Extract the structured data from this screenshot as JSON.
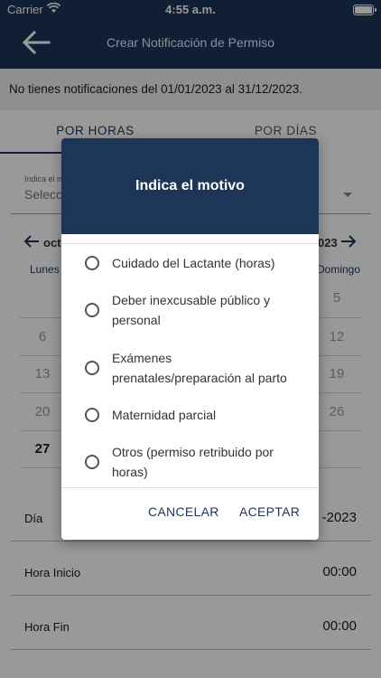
{
  "status_bar": {
    "carrier": "Carrier",
    "time": "4:55 a.m."
  },
  "header": {
    "title": "Crear Notificación de Permiso"
  },
  "banner": {
    "text": "No tienes notificaciones del 01/01/2023 al 31/12/2023."
  },
  "tabs": [
    {
      "label": "POR HORAS",
      "active": true
    },
    {
      "label": "POR DÍAS",
      "active": false
    }
  ],
  "reason_select": {
    "label": "Indica el m",
    "value": "Selecc"
  },
  "calendar": {
    "month_left": "oct",
    "month_right": "023",
    "weekdays": {
      "first": "Lunes",
      "last": "Domingo"
    },
    "left_column": [
      "6",
      "13",
      "20",
      "27"
    ],
    "right_column": [
      "5",
      "12",
      "19",
      "26"
    ]
  },
  "form": {
    "day_label": "Día",
    "day_value": "-2023",
    "start_label": "Hora Inicio",
    "start_value": "00:00",
    "end_label": "Hora Fin",
    "end_value": "00:00"
  },
  "dialog": {
    "title": "Indica el motivo",
    "options": [
      "Cuidado del Lactante (horas)",
      "Deber inexcusable público y personal",
      "Exámenes prenatales/preparación al parto",
      "Maternidad parcial",
      "Otros (permiso retribuido por horas)"
    ],
    "cancel": "CANCELAR",
    "accept": "ACEPTAR"
  }
}
